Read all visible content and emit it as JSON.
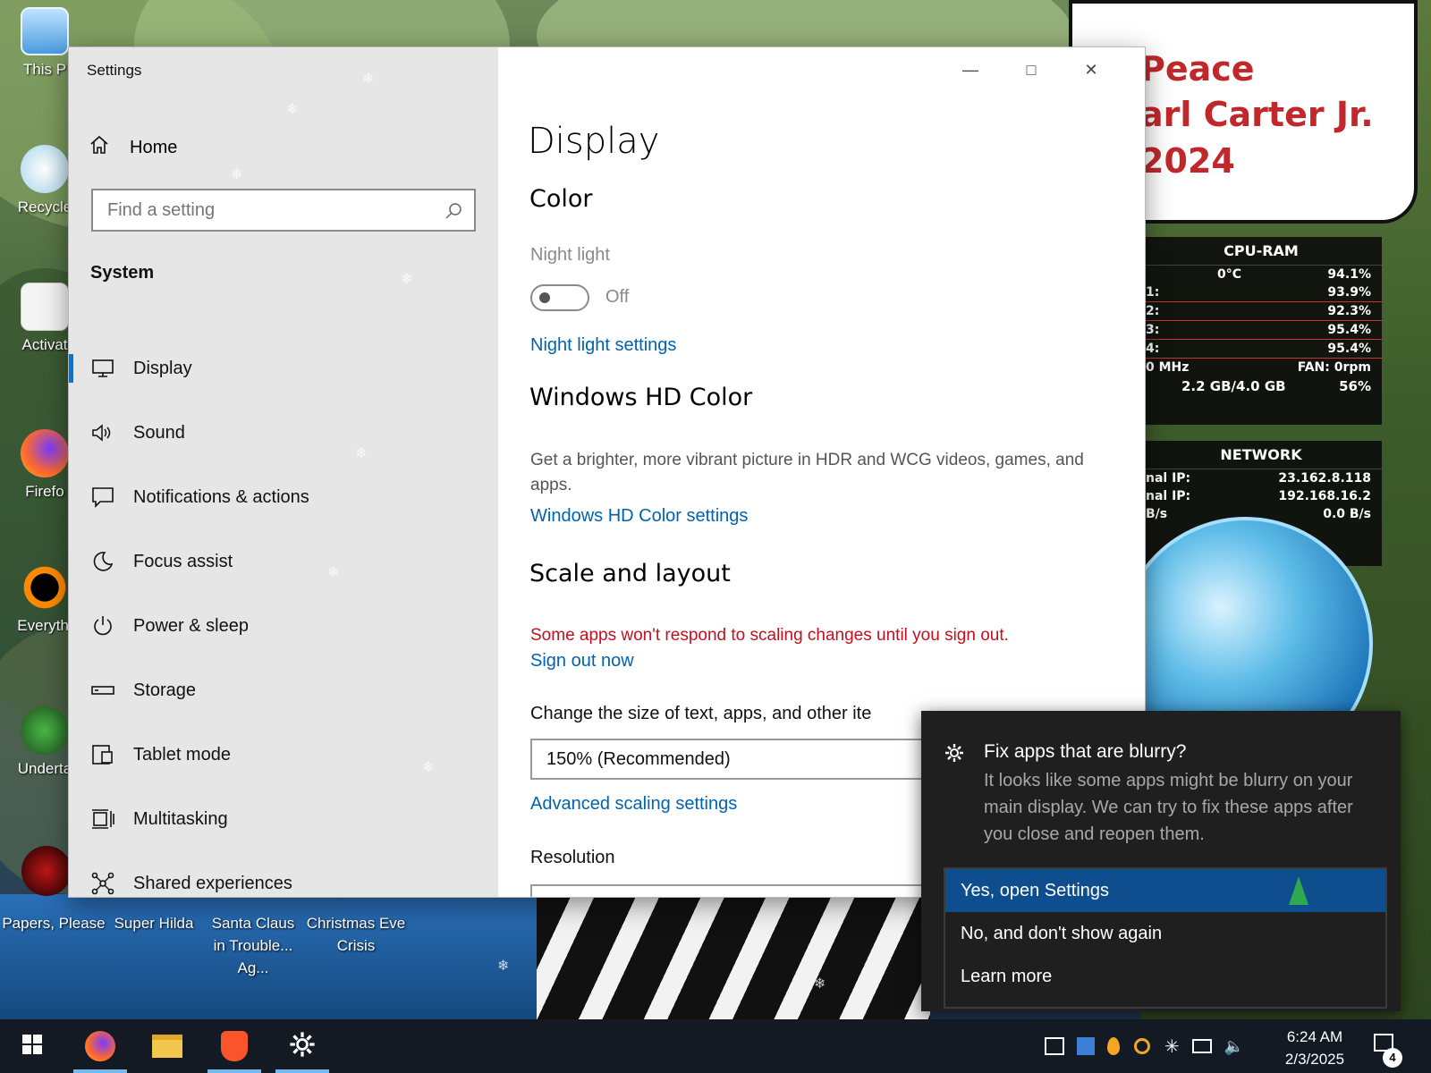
{
  "desktop": {
    "icons": [
      {
        "label": "This P"
      },
      {
        "label": "Recycle"
      },
      {
        "label": "Activat"
      },
      {
        "label": "Firefo"
      },
      {
        "label": "Everythi"
      },
      {
        "label": "Underta"
      }
    ],
    "bottom_icons": [
      {
        "label": "Papers, Please"
      },
      {
        "label": "Super Hilda"
      },
      {
        "label": "Santa Claus in Trouble... Ag..."
      },
      {
        "label": "Christmas Eve Crisis"
      }
    ],
    "banner_lines": [
      "Peace",
      "arl Carter Jr.",
      "2024"
    ]
  },
  "gadgets": {
    "cpu_ram": {
      "title": "CPU-RAM",
      "temp": "0°C",
      "total": "94.1%",
      "cores": [
        {
          "label": "1:",
          "value": "93.9%"
        },
        {
          "label": "2:",
          "value": "92.3%"
        },
        {
          "label": "3:",
          "value": "95.4%"
        },
        {
          "label": "4:",
          "value": "95.4%"
        }
      ],
      "freq": "0 MHz",
      "fan": "FAN: 0rpm",
      "ram": "2.2 GB/4.0 GB",
      "ram_pct": "56%"
    },
    "network": {
      "title": "NETWORK",
      "rows": [
        {
          "label": "nal IP:",
          "value": "23.162.8.118"
        },
        {
          "label": "nal IP:",
          "value": "192.168.16.2"
        },
        {
          "label": "B/s",
          "value": "0.0 B/s"
        }
      ]
    }
  },
  "window": {
    "title": "Settings",
    "sidebar": {
      "home_label": "Home",
      "search_placeholder": "Find a setting",
      "section": "System",
      "items": [
        {
          "label": "Display",
          "icon": "monitor-icon"
        },
        {
          "label": "Sound",
          "icon": "speaker-icon"
        },
        {
          "label": "Notifications & actions",
          "icon": "notification-icon"
        },
        {
          "label": "Focus assist",
          "icon": "moon-icon"
        },
        {
          "label": "Power & sleep",
          "icon": "power-icon"
        },
        {
          "label": "Storage",
          "icon": "storage-icon"
        },
        {
          "label": "Tablet mode",
          "icon": "tablet-icon"
        },
        {
          "label": "Multitasking",
          "icon": "multitasking-icon"
        },
        {
          "label": "Shared experiences",
          "icon": "shared-experiences-icon"
        }
      ]
    },
    "content": {
      "title": "Display",
      "color_heading": "Color",
      "night_light_label": "Night light",
      "night_light_state": "Off",
      "night_light_link": "Night light settings",
      "hd_heading": "Windows HD Color",
      "hd_desc": "Get a brighter, more vibrant picture in HDR and WCG videos, games, and apps.",
      "hd_link": "Windows HD Color settings",
      "scale_heading": "Scale and layout",
      "scale_warning": "Some apps won't respond to scaling changes until you sign out.",
      "sign_out_link": "Sign out now",
      "size_label": "Change the size of text, apps, and other ite",
      "size_value": "150% (Recommended)",
      "advanced_link": "Advanced scaling settings",
      "resolution_label": "Resolution"
    }
  },
  "toast": {
    "title": "Fix apps that are blurry?",
    "body": "It looks like some apps might be blurry on your main display. We can try to fix these apps after you close and reopen them.",
    "options": [
      "Yes, open Settings",
      "No, and don't show again",
      "Learn more"
    ]
  },
  "taskbar": {
    "time": "6:24 AM",
    "date": "2/3/2025",
    "notification_count": "4"
  },
  "colors": {
    "accent": "#0078d7",
    "link": "#0063b1",
    "warning": "#c50f1f",
    "taskbar": "#141a23",
    "toast_selected": "#0e4e8f"
  }
}
